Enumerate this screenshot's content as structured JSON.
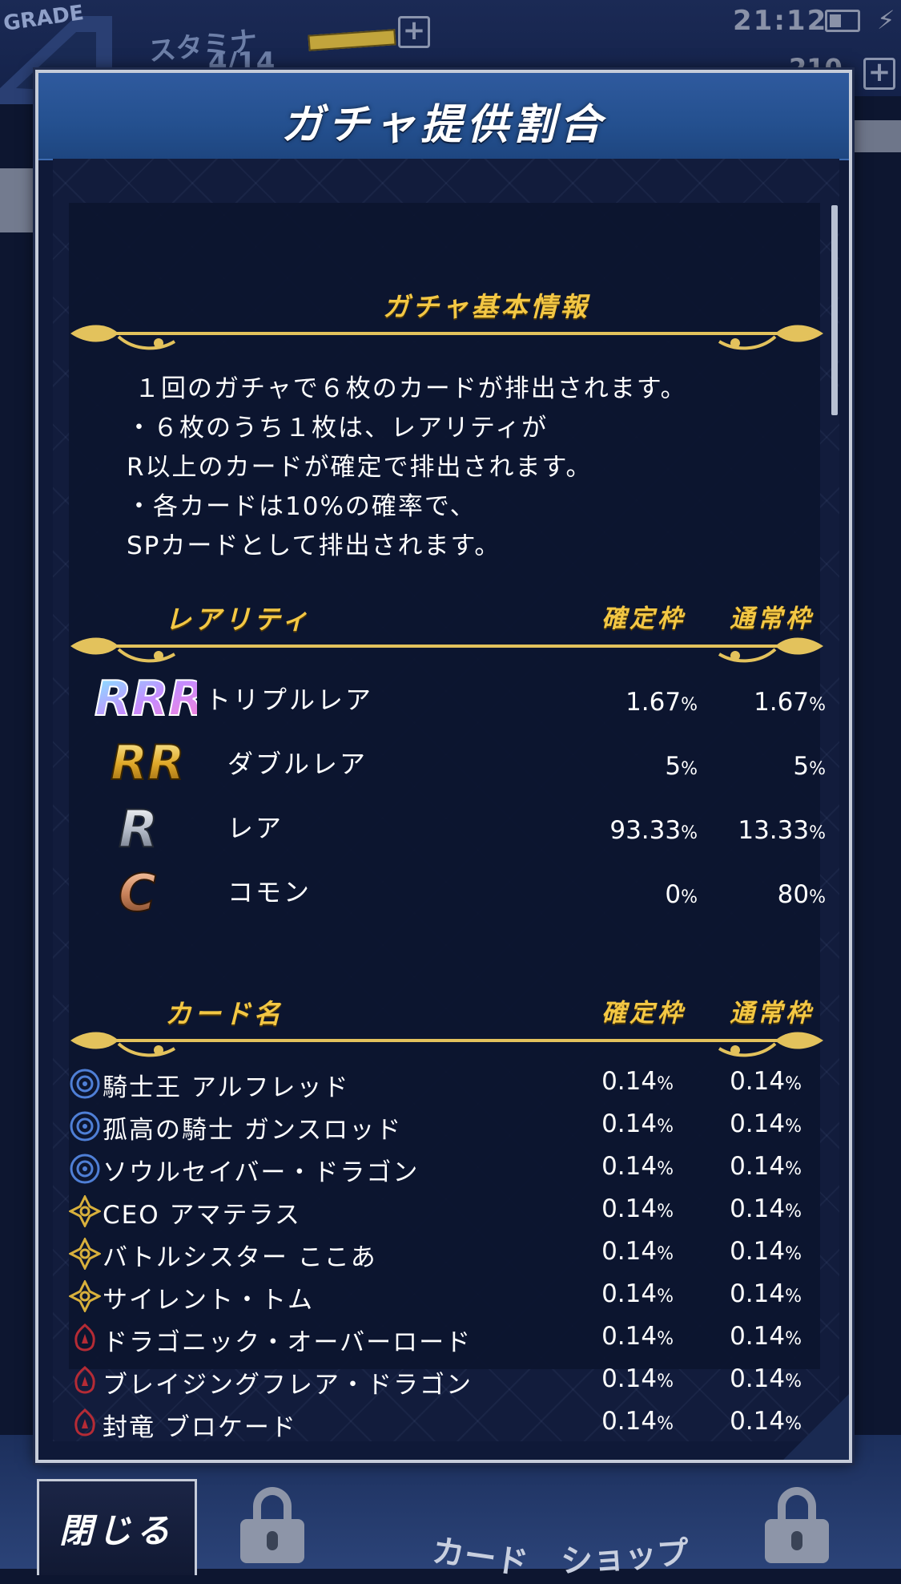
{
  "status_bar": {
    "grade_label": "GRADE",
    "stamina_label": "スタミナ",
    "stamina_value": "4/14",
    "coin_value": "210",
    "clock": "21:12"
  },
  "dialog": {
    "title": "ガチャ提供割合",
    "info_section": {
      "title": "ガチャ基本情報",
      "lines": [
        "１回のガチャで６枚のカードが排出されます。",
        "・６枚のうち１枚は、レアリティが",
        "R以上のカードが確定で排出されます。",
        "・各カードは10%の確率で、",
        "SPカードとして排出されます。"
      ]
    },
    "rarity_section": {
      "title": "レアリティ",
      "col_guaranteed": "確定枠",
      "col_normal": "通常枠",
      "rows": [
        {
          "badge": "RRR",
          "name": "トリプルレア",
          "guaranteed": "1.67",
          "normal": "1.67"
        },
        {
          "badge": "RR",
          "name": "ダブルレア",
          "guaranteed": "5",
          "normal": "5"
        },
        {
          "badge": "R",
          "name": "レア",
          "guaranteed": "93.33",
          "normal": "13.33"
        },
        {
          "badge": "C",
          "name": "コモン",
          "guaranteed": "0",
          "normal": "80"
        }
      ],
      "unit": "%"
    },
    "card_section": {
      "title": "カード名",
      "col_guaranteed": "確定枠",
      "col_normal": "通常枠",
      "rows": [
        {
          "clan": "blue",
          "name": "騎士王 アルフレッド",
          "guaranteed": "0.14",
          "normal": "0.14"
        },
        {
          "clan": "blue",
          "name": "孤高の騎士 ガンスロッド",
          "guaranteed": "0.14",
          "normal": "0.14"
        },
        {
          "clan": "blue",
          "name": "ソウルセイバー・ドラゴン",
          "guaranteed": "0.14",
          "normal": "0.14"
        },
        {
          "clan": "gold",
          "name": "CEO アマテラス",
          "guaranteed": "0.14",
          "normal": "0.14"
        },
        {
          "clan": "gold",
          "name": "バトルシスター ここあ",
          "guaranteed": "0.14",
          "normal": "0.14"
        },
        {
          "clan": "gold",
          "name": "サイレント・トム",
          "guaranteed": "0.14",
          "normal": "0.14"
        },
        {
          "clan": "red",
          "name": "ドラゴニック・オーバーロード",
          "guaranteed": "0.14",
          "normal": "0.14"
        },
        {
          "clan": "red",
          "name": "ブレイジングフレア・ドラゴン",
          "guaranteed": "0.14",
          "normal": "0.14"
        },
        {
          "clan": "red",
          "name": "封竜 ブロケード",
          "guaranteed": "0.14",
          "normal": "0.14"
        }
      ],
      "unit": "%"
    },
    "scroll_position": 0.0
  },
  "close_button": {
    "label": "閉じる"
  },
  "bottom_nav": {
    "card_label": "カード",
    "shop_label": "ショップ"
  },
  "colors": {
    "accent_gold": "#f3c744",
    "header_blue": "#2f5a9e",
    "panel_bg": "#0c142e",
    "clan_blue": "#4f7fd6",
    "clan_gold": "#d8b03c",
    "clan_red": "#b52b35"
  }
}
